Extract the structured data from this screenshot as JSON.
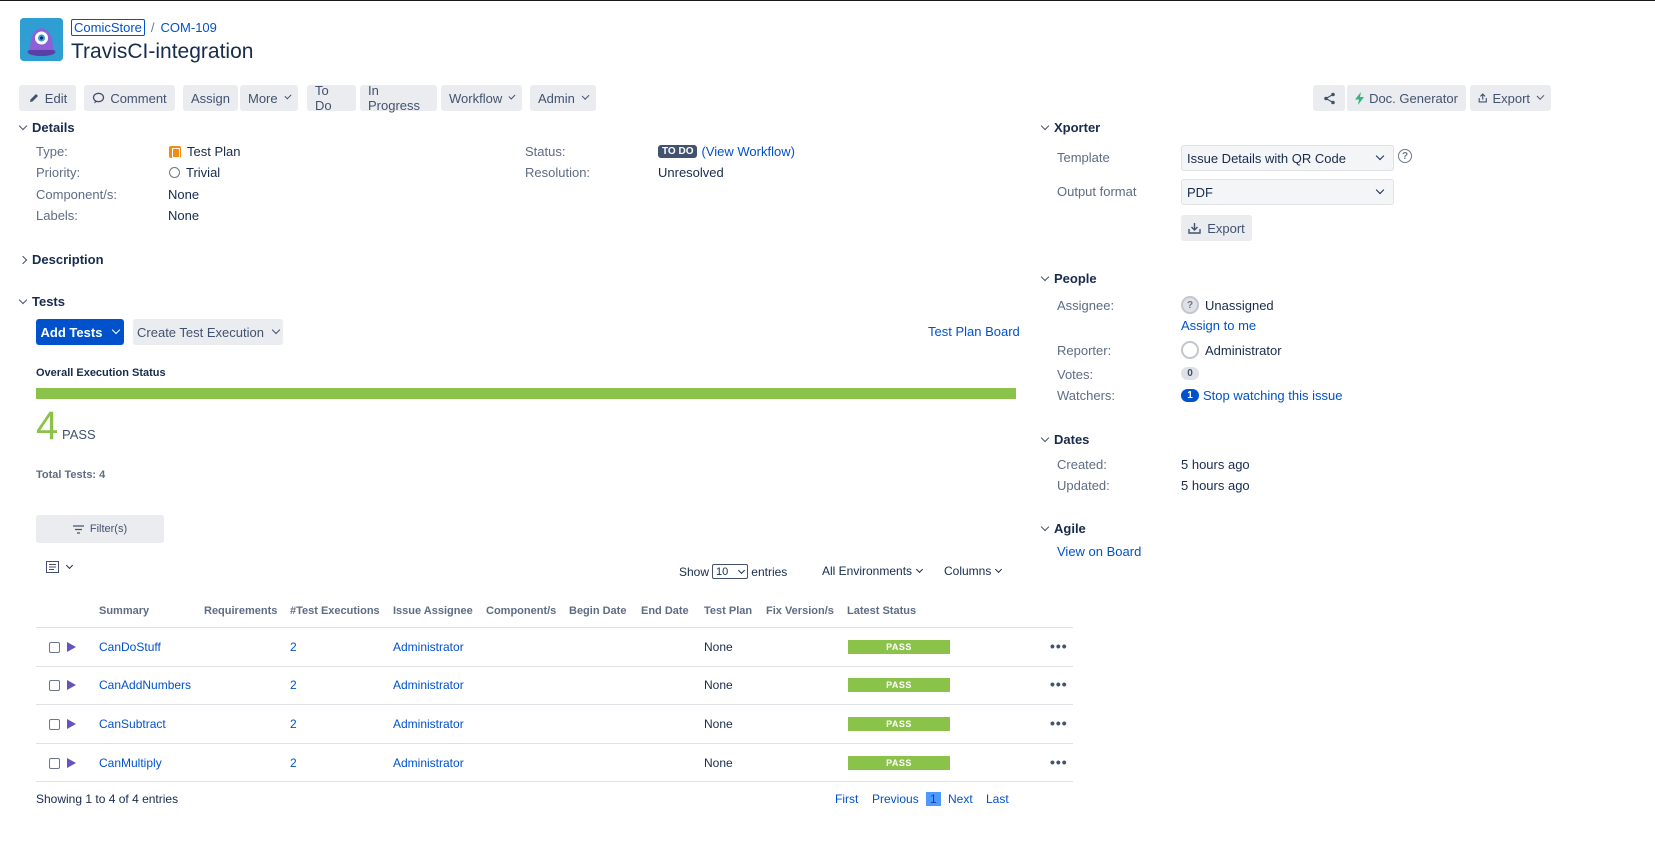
{
  "header": {
    "project": "ComicStore",
    "issue_key": "COM-109",
    "title": "TravisCI-integration"
  },
  "toolbar": {
    "edit": "Edit",
    "comment": "Comment",
    "assign": "Assign",
    "more": "More",
    "todo": "To Do",
    "in_progress": "In Progress",
    "workflow": "Workflow",
    "admin": "Admin",
    "doc_generator": "Doc. Generator",
    "export": "Export"
  },
  "details": {
    "heading": "Details",
    "type_label": "Type:",
    "type_value": "Test Plan",
    "priority_label": "Priority:",
    "priority_value": "Trivial",
    "components_label": "Component/s:",
    "components_value": "None",
    "labels_label": "Labels:",
    "labels_value": "None",
    "status_label": "Status:",
    "status_badge": "TO DO",
    "view_workflow": "(View Workflow)",
    "resolution_label": "Resolution:",
    "resolution_value": "Unresolved"
  },
  "description": {
    "heading": "Description"
  },
  "tests": {
    "heading": "Tests",
    "add_tests": "Add Tests",
    "create_execution": "Create Test Execution",
    "plan_board": "Test Plan Board",
    "overall_label": "Overall Execution Status",
    "pass_fraction": 1.0,
    "pass_count": "4",
    "pass_word": "PASS",
    "total": "Total Tests: 4",
    "filters": "Filter(s)",
    "show": "Show",
    "entries_count": "10",
    "entries": "entries",
    "environments": "All Environments",
    "columns": "Columns",
    "table": {
      "headers": [
        "Summary",
        "Requirements",
        "#Test Executions",
        "Issue Assignee",
        "Component/s",
        "Begin Date",
        "End Date",
        "Test Plan",
        "Fix Version/s",
        "Latest Status"
      ],
      "rows": [
        {
          "summary": "CanDoStuff",
          "executions": "2",
          "assignee": "Administrator",
          "test_plan": "None",
          "status": "PASS"
        },
        {
          "summary": "CanAddNumbers",
          "executions": "2",
          "assignee": "Administrator",
          "test_plan": "None",
          "status": "PASS"
        },
        {
          "summary": "CanSubtract",
          "executions": "2",
          "assignee": "Administrator",
          "test_plan": "None",
          "status": "PASS"
        },
        {
          "summary": "CanMultiply",
          "executions": "2",
          "assignee": "Administrator",
          "test_plan": "None",
          "status": "PASS"
        }
      ]
    },
    "showing": "Showing 1 to 4 of 4 entries",
    "pager": {
      "first": "First",
      "previous": "Previous",
      "page": "1",
      "next": "Next",
      "last": "Last"
    }
  },
  "xporter": {
    "heading": "Xporter",
    "template_label": "Template",
    "template_value": "Issue Details with QR Code",
    "output_label": "Output format",
    "output_value": "PDF",
    "export_button": "Export"
  },
  "people": {
    "heading": "People",
    "assignee_label": "Assignee:",
    "assignee_value": "Unassigned",
    "assign_to_me": "Assign to me",
    "reporter_label": "Reporter:",
    "reporter_value": "Administrator",
    "votes_label": "Votes:",
    "votes_count": "0",
    "watchers_label": "Watchers:",
    "watchers_count": "1",
    "stop_watching": "Stop watching this issue"
  },
  "dates": {
    "heading": "Dates",
    "created_label": "Created:",
    "created_value": "5 hours ago",
    "updated_label": "Updated:",
    "updated_value": "5 hours ago"
  },
  "agile": {
    "heading": "Agile",
    "view_on_board": "View on Board"
  },
  "colors": {
    "primary": "#0052cc",
    "pass": "#8bc34a",
    "todo_badge": "#42526e",
    "test_icon": "#6554c0"
  }
}
